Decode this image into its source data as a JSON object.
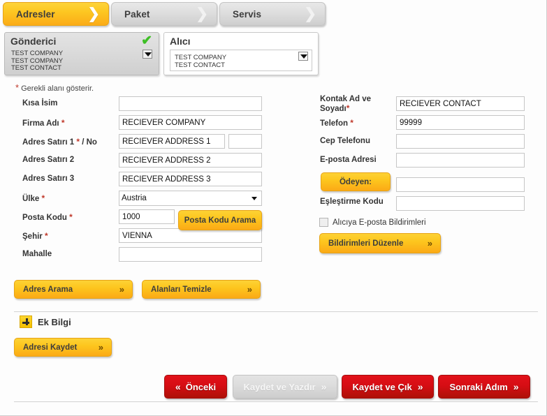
{
  "tabs": [
    {
      "label": "Adresler",
      "icon": "chevron-right-icon",
      "active": true
    },
    {
      "label": "Paket",
      "icon": "chevron-right-icon",
      "active": false
    },
    {
      "label": "Servis",
      "icon": "chevron-right-icon",
      "active": false
    }
  ],
  "sender_panel": {
    "title": "Gönderici",
    "status_icon": "green-check-icon",
    "dropdown_icon": "chevron-down-icon",
    "lines": [
      "TEST COMPANY",
      "TEST COMPANY",
      "TEST CONTACT"
    ]
  },
  "receiver_panel": {
    "title": "Alıcı",
    "dropdown_icon": "chevron-down-icon",
    "lines": [
      "TEST COMPANY",
      "TEST CONTACT"
    ]
  },
  "required_note": {
    "star": "*",
    "text": "Gerekli alanı gösterir."
  },
  "form_left": {
    "short_name": {
      "label": "Kısa İsim",
      "value": "",
      "required": false
    },
    "company": {
      "label": "Firma Adı",
      "value": "RECIEVER COMPANY",
      "required": true,
      "star": "*"
    },
    "address1": {
      "label": "Adres Satırı 1",
      "star": "*",
      "suffix": "/ No",
      "value": "RECIEVER ADDRESS 1",
      "no_value": ""
    },
    "address2": {
      "label": "Adres Satırı 2",
      "value": "RECIEVER ADDRESS 2"
    },
    "address3": {
      "label": "Adres Satırı 3",
      "value": "RECIEVER ADDRESS 3"
    },
    "country": {
      "label": "Ülke",
      "star": "*",
      "value": "Austria",
      "options": [
        "Austria"
      ],
      "arrow_icon": "select-arrow-icon"
    },
    "zip": {
      "label": "Posta Kodu",
      "star": "*",
      "value": "1000"
    },
    "zip_search_button": {
      "label": "Posta Kodu Arama"
    },
    "city": {
      "label": "Şehir",
      "star": "*",
      "value": "VIENNA"
    },
    "district": {
      "label": "Mahalle",
      "value": ""
    }
  },
  "form_right": {
    "contact_name": {
      "label": "Kontak Ad ve Soyadı",
      "label_line1": "Kontak Ad ve",
      "label_line2": "Soyadı",
      "star": "*",
      "value": "RECIEVER CONTACT"
    },
    "phone": {
      "label": "Telefon",
      "star": "*",
      "value": "99999"
    },
    "mobile": {
      "label": "Cep Telefonu",
      "value": ""
    },
    "email": {
      "label": "E-posta Adresi",
      "value": ""
    },
    "payer_button": {
      "label": "Ödeyen:"
    },
    "payer_value": "",
    "match_code": {
      "label": "Eşleştirme Kodu",
      "value": ""
    },
    "notify_checkbox": {
      "label": "Alıcıya E-posta Bildirimleri",
      "checked": false
    },
    "notify_edit_button": {
      "label": "Bildirimleri Düzenle",
      "icon": "double-chevron-right-icon"
    }
  },
  "left_actions": {
    "address_search": {
      "label": "Adres Arama",
      "icon": "double-chevron-right-icon"
    },
    "clear_fields": {
      "label": "Alanları Temizle",
      "icon": "double-chevron-right-icon"
    },
    "save_address": {
      "label": "Adresi Kaydet",
      "icon": "double-chevron-right-icon"
    }
  },
  "extra_info": {
    "label": "Ek Bilgi",
    "icon": "plus-icon"
  },
  "bottom_actions": [
    {
      "label": "Önceki",
      "icon": "double-chevron-left-icon",
      "glyph": "«",
      "style": "red",
      "disabled": false
    },
    {
      "label": "Kaydet ve Yazdır",
      "icon": "double-chevron-right-icon",
      "glyph": "»",
      "style": "gray",
      "disabled": true
    },
    {
      "label": "Kaydet ve Çık",
      "icon": "double-chevron-right-icon",
      "glyph": "»",
      "style": "red",
      "disabled": false
    },
    {
      "label": "Sonraki Adım",
      "icon": "double-chevron-right-icon",
      "glyph": "»",
      "style": "red",
      "disabled": false
    }
  ],
  "colors": {
    "accent_yellow": "#fdc61e",
    "accent_orange": "#fbaa16",
    "primary_red": "#d60d14",
    "disabled_gray": "#dcdcdc",
    "required_star": "#c0392b",
    "check_green": "#3dbf25",
    "page_bg": "#fdfdfd"
  },
  "glyphs": {
    "chevron_right": "❯",
    "double_right": "»",
    "double_left": "«",
    "check": "✔"
  }
}
